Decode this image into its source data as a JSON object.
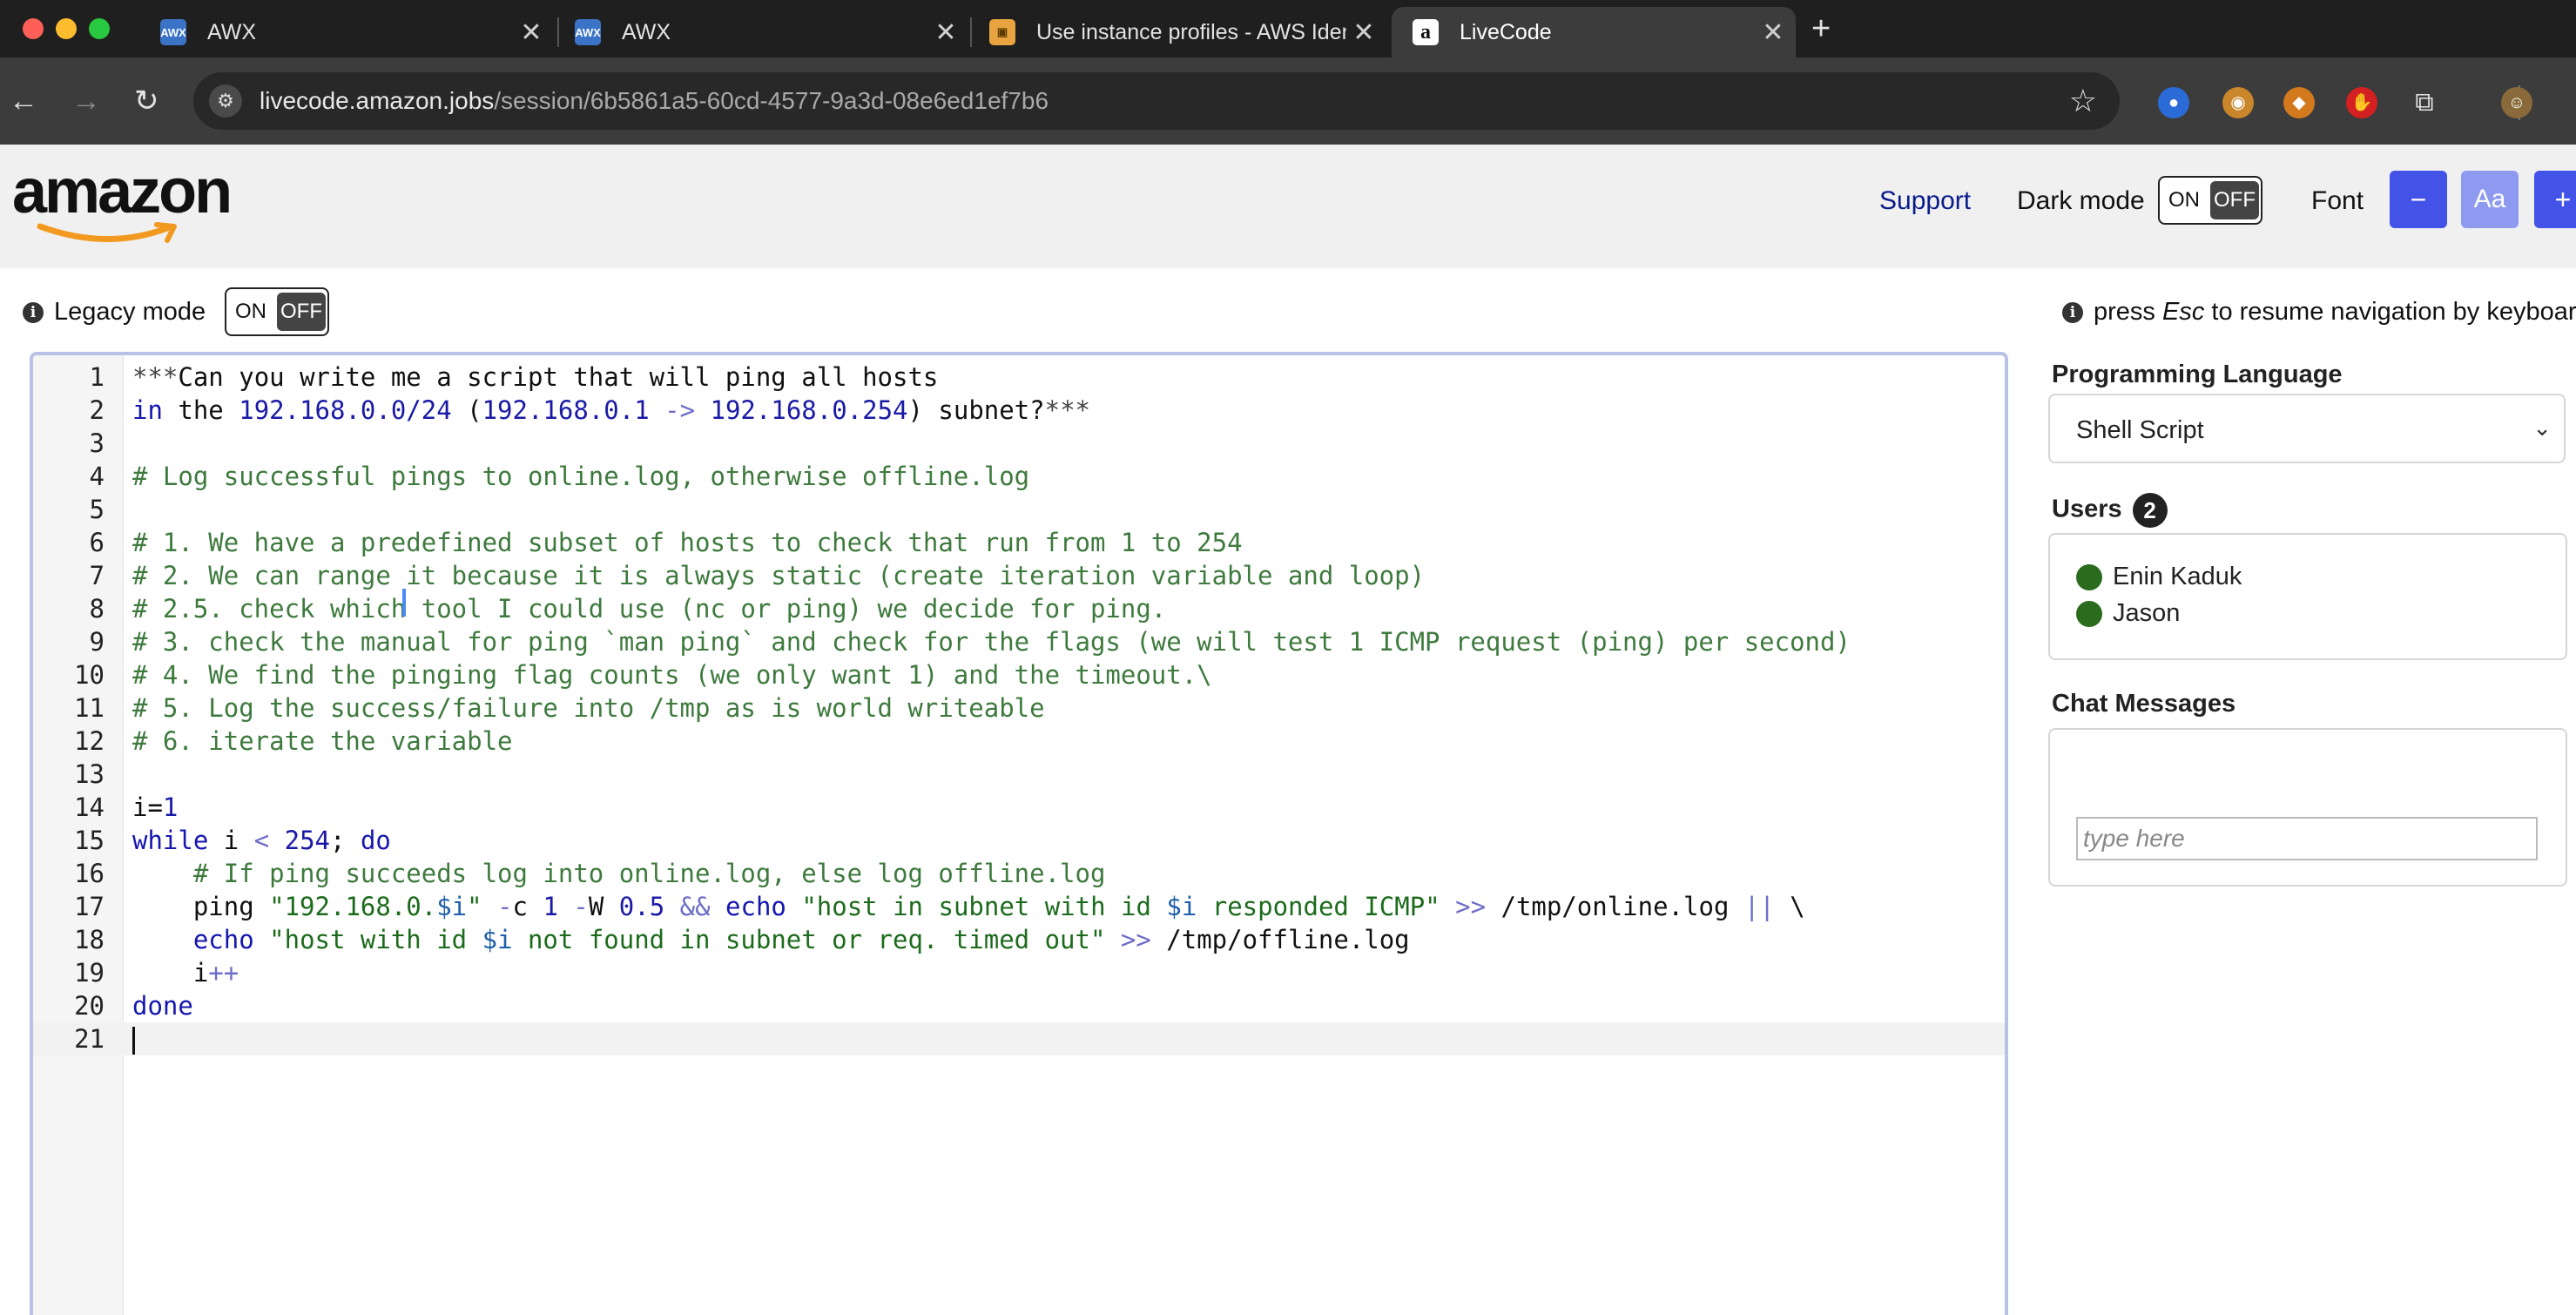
{
  "browser": {
    "tabs": [
      {
        "title": "AWX",
        "favicon": "awx-icon"
      },
      {
        "title": "AWX",
        "favicon": "awx-icon"
      },
      {
        "title": "Use instance profiles - AWS Identity",
        "favicon": "aws-box-icon"
      },
      {
        "title": "LiveCode",
        "favicon": "amazon-a-icon"
      }
    ],
    "url_domain": "livecode.amazon.jobs",
    "url_path": "/session/6b5861a5-60cd-4577-9a3d-08e6ed1ef7b6",
    "icons": {
      "back": "←",
      "forward": "→",
      "reload": "↻",
      "star": "☆",
      "new_tab": "+",
      "close": "✕"
    }
  },
  "header": {
    "logo": "amazon",
    "support": "Support",
    "dark_mode_label": "Dark mode",
    "toggle_on": "ON",
    "toggle_off": "OFF",
    "font_label": "Font",
    "font_minus": "−",
    "font_aa": "Aa",
    "font_plus": "+"
  },
  "subbar": {
    "legacy_label": "Legacy mode",
    "info": "i",
    "esc_hint_pre": "press ",
    "esc_hint_key": "Esc",
    "esc_hint_post": " to resume navigation by keyboard"
  },
  "editor": {
    "lines": [
      "***Can you write me a script that will ping all hosts",
      "in the 192.168.0.0/24 (192.168.0.1 -> 192.168.0.254) subnet?***",
      "",
      "# Log successful pings to online.log, otherwise offline.log",
      "",
      "# 1. We have a predefined subset of hosts to check that run from 1 to 254",
      "# 2. We can range it because it is always static (create iteration variable and loop)",
      "# 2.5. check which tool I could use (nc or ping) we decide for ping.",
      "# 3. check the manual for ping `man ping` and check for the flags (we will test 1 ICMP request (ping) per second)",
      "# 4. We find the pinging flag counts (we only want 1) and the timeout.\\",
      "# 5. Log the success/failure into /tmp as is world writeable",
      "# 6. iterate the variable",
      "",
      "i=1",
      "while i < 254; do",
      "    # If ping succeeds log into online.log, else log offline.log",
      "    ping \"192.168.0.$i\" -c 1 -W 0.5 && echo \"host in subnet with id $i responded ICMP\" >> /tmp/online.log || \\",
      "    echo \"host with id $i not found in subnet or req. timed out\" >> /tmp/offline.log",
      "    i++",
      "done",
      ""
    ],
    "active_line": 21
  },
  "panel": {
    "language_heading": "Programming Language",
    "language_value": "Shell Script",
    "users_heading": "Users",
    "users_count": "2",
    "users": [
      "Enin Kaduk",
      "Jason"
    ],
    "chat_heading": "Chat Messages",
    "chat_placeholder": "type here"
  },
  "colors": {
    "accent_button": "#4353e8",
    "accent_button_light": "#8e9af0",
    "comment": "#3e7a3e",
    "keyword": "#1616b0",
    "user_online": "#2a6b1d"
  }
}
